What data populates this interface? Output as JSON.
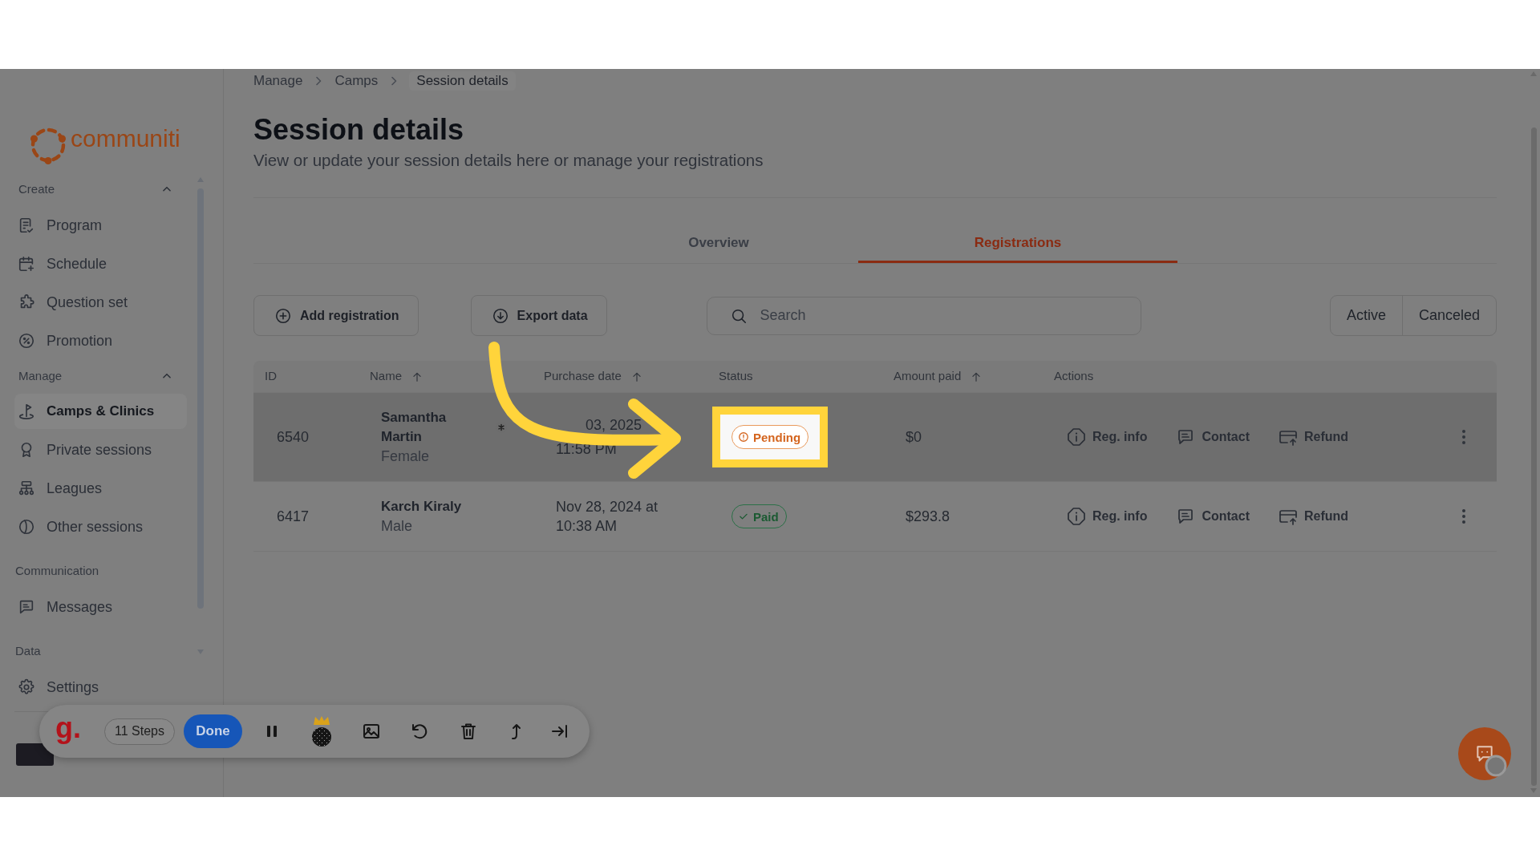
{
  "breadcrumbs": [
    {
      "label": "Manage",
      "current": false
    },
    {
      "label": "Camps",
      "current": false
    },
    {
      "label": "Session details",
      "current": true
    }
  ],
  "sidebar": {
    "logo_text": "communiti",
    "sections": [
      {
        "title": "Create",
        "expanded": true,
        "items": [
          {
            "label": "Program",
            "selected": false
          },
          {
            "label": "Schedule",
            "selected": false
          },
          {
            "label": "Question set",
            "selected": false
          },
          {
            "label": "Promotion",
            "selected": false
          }
        ]
      },
      {
        "title": "Manage",
        "expanded": true,
        "items": [
          {
            "label": "Camps & Clinics",
            "selected": true
          },
          {
            "label": "Private sessions",
            "selected": false
          },
          {
            "label": "Leagues",
            "selected": false
          },
          {
            "label": "Other sessions",
            "selected": false
          }
        ]
      },
      {
        "title": "Communication",
        "items": [
          {
            "label": "Messages",
            "selected": false
          }
        ]
      },
      {
        "title": "Data",
        "items": [
          {
            "label": "Settings",
            "selected": false
          }
        ]
      }
    ]
  },
  "page": {
    "title": "Session details",
    "subtitle": "View or update your session details here or manage your registrations"
  },
  "tabs": [
    {
      "label": "Overview",
      "selected": false
    },
    {
      "label": "Registrations",
      "selected": true
    }
  ],
  "toolbar": {
    "buttons": [
      {
        "label": "Add registration"
      },
      {
        "label": "Export data"
      }
    ],
    "search": {
      "placeholder": "Search"
    },
    "filters": [
      {
        "label": "Active"
      },
      {
        "label": "Canceled"
      }
    ]
  },
  "table": {
    "columns": [
      {
        "label": "ID",
        "sorted": false
      },
      {
        "label": "Name",
        "sorted": true
      },
      {
        "label": "Purchase date",
        "sorted": true
      },
      {
        "label": "Status",
        "sorted": false
      },
      {
        "label": "Amount paid",
        "sorted": true
      },
      {
        "label": "Actions",
        "sorted": false
      }
    ],
    "rows": [
      {
        "id": "6540",
        "name": "Samantha Martin",
        "gender": "Female",
        "marker": true,
        "purchase_date": "03, 2025\n11:58 PM",
        "status": {
          "label": "Pending",
          "kind": "pending"
        },
        "amount": "$0",
        "actions": [
          {
            "label": "Reg. info"
          },
          {
            "label": "Contact"
          },
          {
            "label": "Refund"
          }
        ],
        "hovered": true,
        "highlighted": true
      },
      {
        "id": "6417",
        "name": "Karch Kiraly",
        "gender": "Male",
        "marker": false,
        "purchase_date": "Nov 28, 2024 at\n10:38 AM",
        "status": {
          "label": "Paid",
          "kind": "paid"
        },
        "amount": "$293.8",
        "actions": [
          {
            "label": "Reg. info"
          },
          {
            "label": "Contact"
          },
          {
            "label": "Refund"
          }
        ],
        "hovered": false,
        "highlighted": false
      }
    ]
  },
  "recorder": {
    "logo": "g.",
    "steps": "11 Steps",
    "done": "Done"
  }
}
